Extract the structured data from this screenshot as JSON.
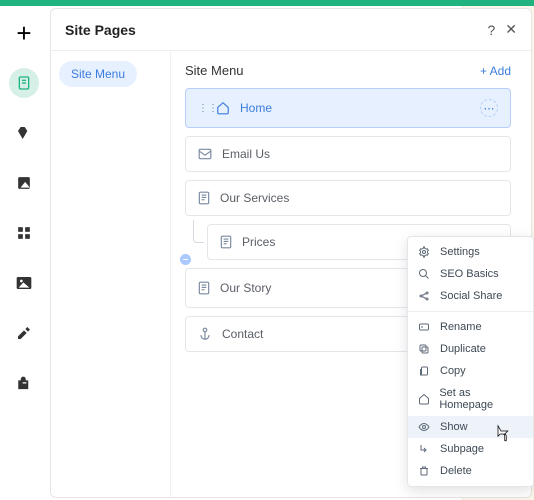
{
  "header": {
    "title": "Site Pages",
    "help": "?",
    "close": "✕"
  },
  "sidebar": {
    "chip": "Site Menu"
  },
  "main": {
    "title": "Site Menu",
    "add_label": "Add",
    "pages": [
      {
        "label": "Home"
      },
      {
        "label": "Email Us"
      },
      {
        "label": "Our Services"
      },
      {
        "label": "Prices"
      },
      {
        "label": "Our Story"
      },
      {
        "label": "Contact"
      }
    ]
  },
  "context_menu": {
    "items_a": [
      {
        "label": "Settings"
      },
      {
        "label": "SEO Basics"
      },
      {
        "label": "Social Share"
      }
    ],
    "items_b": [
      {
        "label": "Rename"
      },
      {
        "label": "Duplicate"
      },
      {
        "label": "Copy"
      },
      {
        "label": "Set as Homepage"
      },
      {
        "label": "Show"
      },
      {
        "label": "Subpage"
      },
      {
        "label": "Delete"
      }
    ]
  }
}
